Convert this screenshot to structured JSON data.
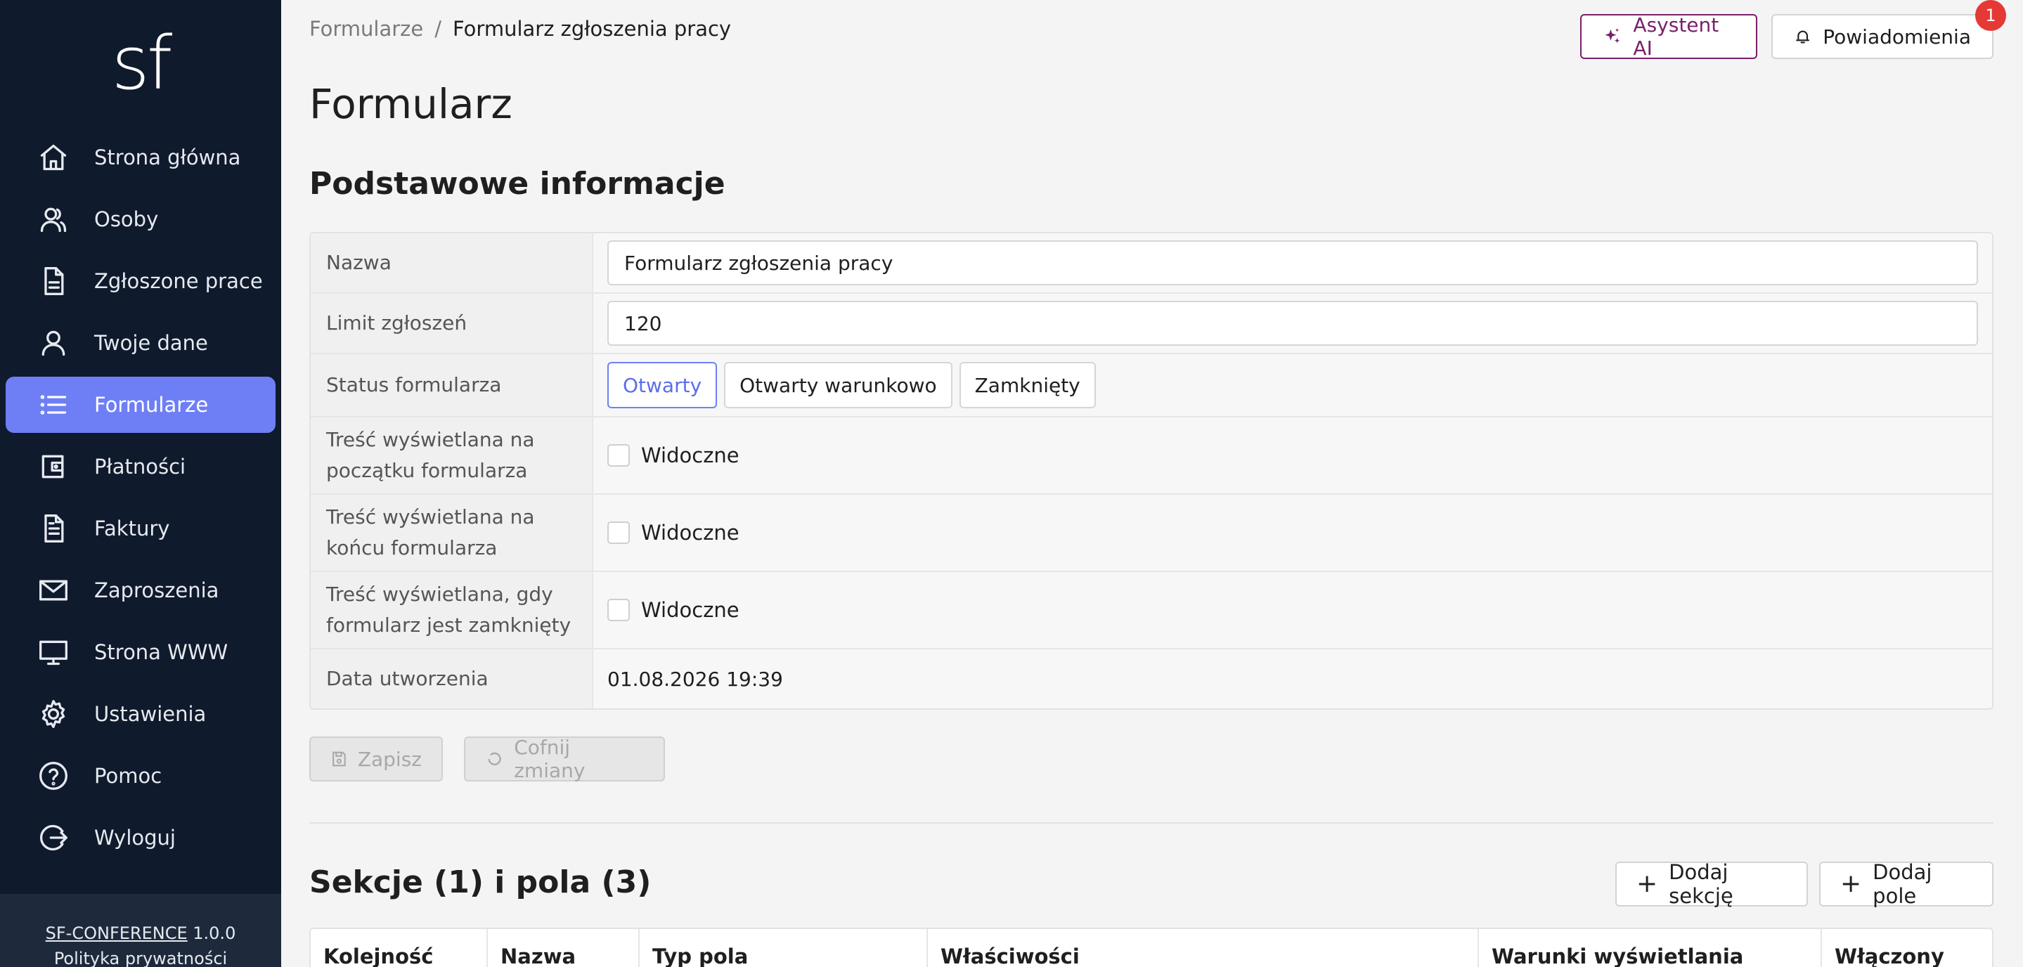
{
  "sidebar": {
    "logo": "sf",
    "items": [
      {
        "label": "Strona główna",
        "icon": "home-icon"
      },
      {
        "label": "Osoby",
        "icon": "users-icon"
      },
      {
        "label": "Zgłoszone prace",
        "icon": "document-icon"
      },
      {
        "label": "Twoje dane",
        "icon": "user-icon"
      },
      {
        "label": "Formularze",
        "icon": "list-icon",
        "active": true
      },
      {
        "label": "Płatności",
        "icon": "wallet-icon"
      },
      {
        "label": "Faktury",
        "icon": "invoice-icon"
      },
      {
        "label": "Zaproszenia",
        "icon": "mail-icon"
      },
      {
        "label": "Strona WWW",
        "icon": "monitor-icon"
      },
      {
        "label": "Ustawienia",
        "icon": "gear-icon"
      },
      {
        "label": "Pomoc",
        "icon": "help-icon"
      },
      {
        "label": "Wyloguj",
        "icon": "logout-icon"
      }
    ],
    "footer": {
      "app_name": "SF-CONFERENCE",
      "version": "1.0.0",
      "privacy": "Polityka prywatności"
    }
  },
  "breadcrumb": {
    "parent": "Formularze",
    "separator": "/",
    "current": "Formularz zgłoszenia pracy"
  },
  "header": {
    "ai_button": "Asystent AI",
    "notifications_button": "Powiadomienia",
    "notifications_count": "1"
  },
  "page_title": "Formularz",
  "basic_info": {
    "title": "Podstawowe informacje",
    "name_label": "Nazwa",
    "name_value": "Formularz zgłoszenia pracy",
    "limit_label": "Limit zgłoszeń",
    "limit_value": "120",
    "status_label": "Status formularza",
    "status_options": [
      "Otwarty",
      "Otwarty warunkowo",
      "Zamknięty"
    ],
    "status_selected": "Otwarty",
    "start_content_label": "Treść wyświetlana na początku formularza",
    "end_content_label": "Treść wyświetlana na końcu formularza",
    "closed_content_label": "Treść wyświetlana, gdy formularz jest zamknięty",
    "visible_label": "Widoczne",
    "created_label": "Data utworzenia",
    "created_value": "01.08.2026 19:39"
  },
  "actions": {
    "save": "Zapisz",
    "revert": "Cofnij zmiany"
  },
  "sections": {
    "title": "Sekcje (1) i pola (3)",
    "add_section": "Dodaj sekcję",
    "add_field": "Dodaj pole",
    "columns": [
      "Kolejność",
      "Nazwa",
      "Typ pola",
      "Właściwości",
      "Warunki wyświetlania",
      "Włączony"
    ]
  }
}
